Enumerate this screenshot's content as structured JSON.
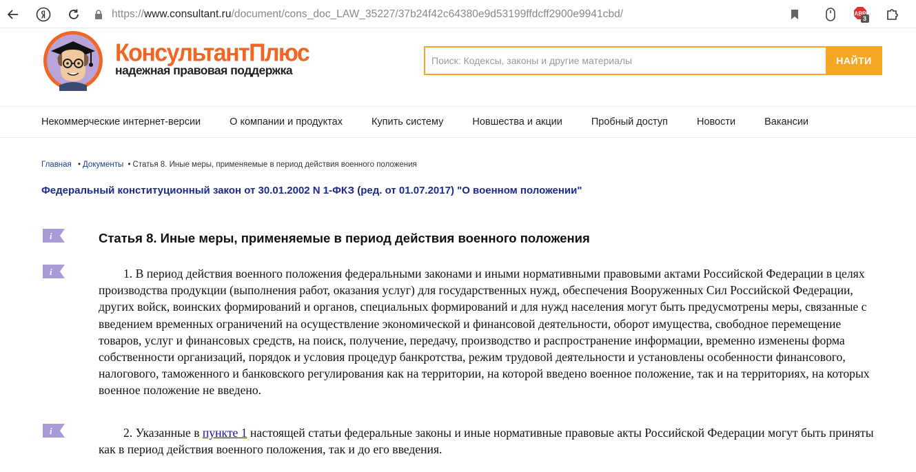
{
  "browser": {
    "url_protocol": "https://",
    "url_host": "www.consultant.ru",
    "url_path": "/document/cons_doc_LAW_35227/37b24f42c64380e9d53199ffdcff2900e9941cbd/",
    "adblock_badge": "3"
  },
  "site": {
    "brand_name": "КонсультантПлюс",
    "brand_tagline": "надежная правовая поддержка",
    "search_placeholder": "Поиск: Кодексы, законы и другие материалы",
    "search_button": "НАЙТИ",
    "accent_color": "#f5a623",
    "brand_color": "#f26522"
  },
  "menu": {
    "items": [
      "Некоммерческие интернет-версии",
      "О компании и продуктах",
      "Купить систему",
      "Новшества и акции",
      "Пробный доступ",
      "Новости",
      "Вакансии"
    ]
  },
  "breadcrumb": {
    "home": "Главная",
    "documents": "Документы",
    "sep": "•",
    "current": "Статья 8. Иные меры, применяемые в период действия военного положения"
  },
  "document": {
    "title": "Федеральный конституционный закон от 30.01.2002 N 1-ФКЗ (ред. от 01.07.2017) \"О военном положении\"",
    "article_heading": "Статья 8. Иные меры, применяемые в период действия военного положения",
    "para1": "1. В период действия военного положения федеральными законами и иными нормативными правовыми актами Российской Федерации в целях производства продукции (выполнения работ, оказания услуг) для государственных нужд, обеспечения Вооруженных Сил Российской Федерации, других войск, воинских формирований и органов, специальных формирований и для нужд населения могут быть предусмотрены меры, связанные с введением временных ограничений на осуществление экономической и финансовой деятельности, оборот имущества, свободное перемещение товаров, услуг и финансовых средств, на поиск, получение, передачу, производство и распространение информации, временно изменены форма собственности организаций, порядок и условия процедур банкротства, режим трудовой деятельности и установлены особенности финансового, налогового, таможенного и банковского регулирования как на территории, на которой введено военное положение, так и на территориях, на которых военное положение не введено.",
    "para2_before": "2. Указанные в ",
    "para2_link": "пункте 1",
    "para2_after": " настоящей статьи федеральные законы и иные нормативные правовые акты Российской Федерации могут быть приняты как в период действия военного положения, так и до его введения."
  }
}
